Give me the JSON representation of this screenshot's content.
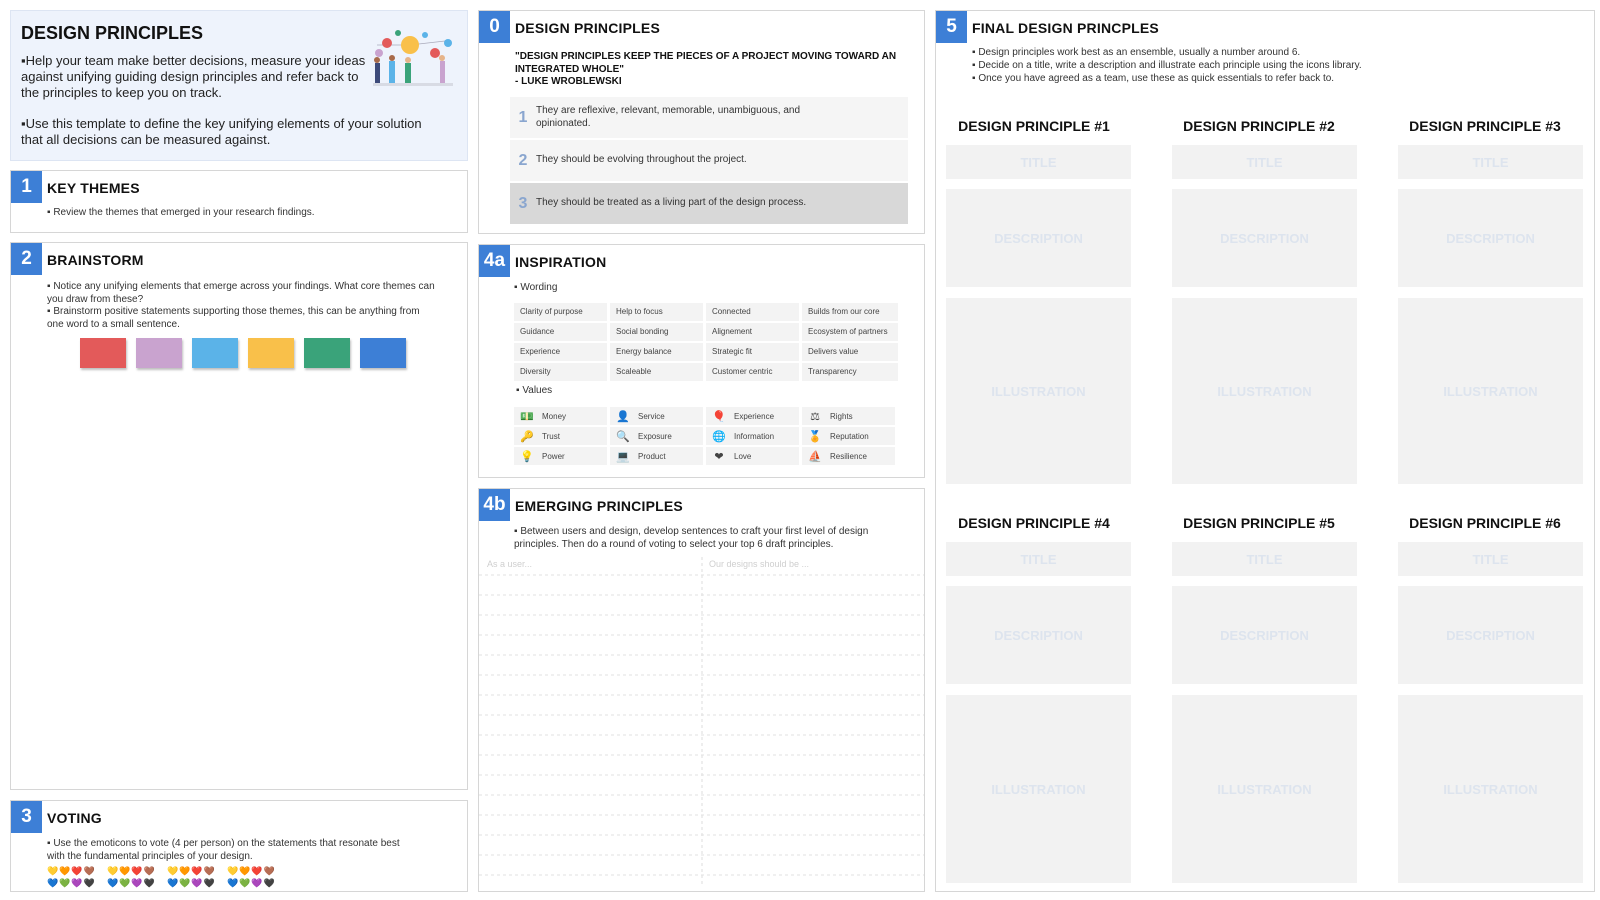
{
  "intro": {
    "title": "DESIGN PRINCIPLES",
    "p1": "Help your team make better decisions, measure your ideas against unifying guiding design principles and refer back to the principles to keep you on track.",
    "p2": "Use this template to define the key unifying elements of your solution that all decisions can be measured against.",
    "illustration_icon": "people-with-balloons-illustration"
  },
  "key_themes": {
    "num": "1",
    "title": "KEY THEMES",
    "bullet": "Review the themes that emerged in your research findings."
  },
  "brainstorm": {
    "num": "2",
    "title": "BRAINSTORM",
    "bullet1": "Notice any unifying elements that emerge across your findings. What core themes can you draw from these?",
    "bullet2": "Brainstorm positive statements supporting those themes, this can be anything from one word to a small sentence.",
    "sticky_colors": [
      "#e35a5a",
      "#c9a3cf",
      "#5bb3e8",
      "#f9c04a",
      "#3aa37a",
      "#3d7fd6"
    ]
  },
  "voting": {
    "num": "3",
    "title": "VOTING",
    "bullet": "Use the emoticons to vote (4 per person) on the statements that resonate best with the fundamental principles of your design.",
    "hearts_row1": "💛🧡❤️🤎",
    "hearts_row2": "💙💚💜🖤"
  },
  "principles": {
    "num": "0",
    "title": "DESIGN PRINCIPLES",
    "quote": "\"DESIGN PRINCIPLES KEEP THE PIECES OF A PROJECT MOVING TOWARD AN INTEGRATED WHOLE\"",
    "author": "- LUKE WROBLEWSKI",
    "items": [
      {
        "n": "1",
        "text": "They are reflexive, relevant, memorable, unambiguous, and opinionated."
      },
      {
        "n": "2",
        "text": "They should be evolving throughout the project."
      },
      {
        "n": "3",
        "text": "They should be treated as a living part of the design process."
      }
    ]
  },
  "inspiration": {
    "num": "4a",
    "title": "INSPIRATION",
    "wording_label": "Wording",
    "wording": [
      "Clarity of purpose",
      "Help to focus",
      "Connected",
      "Builds from our core",
      "Guidance",
      "Social bonding",
      "Alignement",
      "Ecosystem of partners",
      "Experience",
      "Energy balance",
      "Strategic fit",
      "Delivers value",
      "Diversity",
      "Scaleable",
      "Customer centric",
      "Transparency"
    ],
    "values_label": "Values",
    "values": [
      {
        "icon": "💵",
        "label": "Money",
        "name": "money-icon"
      },
      {
        "icon": "👤",
        "label": "Service",
        "name": "service-icon"
      },
      {
        "icon": "🎈",
        "label": "Experience",
        "name": "balloon-icon"
      },
      {
        "icon": "⚖",
        "label": "Rights",
        "name": "scales-icon"
      },
      {
        "icon": "🔑",
        "label": "Trust",
        "name": "key-icon"
      },
      {
        "icon": "🔍",
        "label": "Exposure",
        "name": "magnifier-icon"
      },
      {
        "icon": "🌐",
        "label": "Information",
        "name": "globe-icon"
      },
      {
        "icon": "🏅",
        "label": "Reputation",
        "name": "medal-icon"
      },
      {
        "icon": "💡",
        "label": "Power",
        "name": "lightbulb-icon"
      },
      {
        "icon": "💻",
        "label": "Product",
        "name": "product-icon"
      },
      {
        "icon": "❤",
        "label": "Love",
        "name": "heart-icon"
      },
      {
        "icon": "⛵",
        "label": "Resilience",
        "name": "boat-icon"
      }
    ]
  },
  "emerging": {
    "num": "4b",
    "title": "EMERGING PRINCIPLES",
    "bullet": "Between users and design, develop sentences to craft your first level of design principles. Then do a round of voting to select your top 6 draft principles.",
    "col1": "As a user...",
    "col2": "Our designs should be ..."
  },
  "final": {
    "num": "5",
    "title": "FINAL DESIGN PRINCPLES",
    "bullets": [
      "Design principles work best as an ensemble, usually a number around 6.",
      "Decide on a title, write a description and illustrate each principle using the icons library.",
      "Once you have agreed as a team, use these as quick essentials to refer back to."
    ],
    "cards": [
      {
        "heading": "DESIGN PRINCIPLE #1",
        "title": "TITLE",
        "description": "DESCRIPTION",
        "illustration": "ILLUSTRATION"
      },
      {
        "heading": "DESIGN PRINCIPLE #2",
        "title": "TITLE",
        "description": "DESCRIPTION",
        "illustration": "ILLUSTRATION"
      },
      {
        "heading": "DESIGN PRINCIPLE #3",
        "title": "TITLE",
        "description": "DESCRIPTION",
        "illustration": "ILLUSTRATION"
      },
      {
        "heading": "DESIGN PRINCIPLE #4",
        "title": "TITLE",
        "description": "DESCRIPTION",
        "illustration": "ILLUSTRATION"
      },
      {
        "heading": "DESIGN PRINCIPLE #5",
        "title": "TITLE",
        "description": "DESCRIPTION",
        "illustration": "ILLUSTRATION"
      },
      {
        "heading": "DESIGN PRINCIPLE #6",
        "title": "TITLE",
        "description": "DESCRIPTION",
        "illustration": "ILLUSTRATION"
      }
    ]
  }
}
